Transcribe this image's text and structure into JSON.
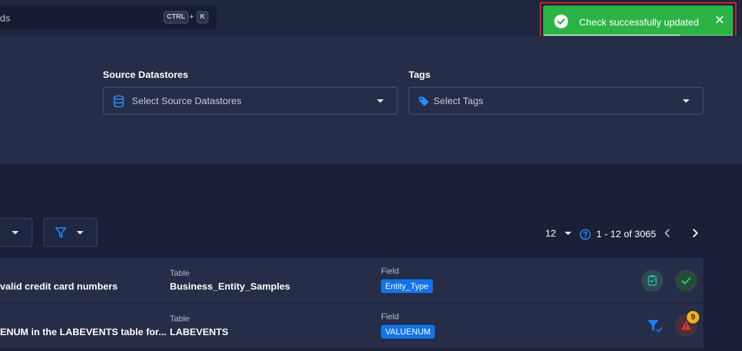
{
  "search": {
    "text": "ds",
    "shortcut_ctrl": "CTRL",
    "shortcut_plus": "+",
    "shortcut_key": "K"
  },
  "toast": {
    "message": "Check successfully updated",
    "close_label": "✕",
    "progress": 0.72,
    "color": "#2bb445"
  },
  "filters": {
    "source_datastores": {
      "label": "Source Datastores",
      "placeholder": "Select Source Datastores",
      "icon": "database-icon"
    },
    "tags": {
      "label": "Tags",
      "placeholder": "Select Tags",
      "icon": "tag-icon"
    }
  },
  "pagination": {
    "page_size": "12",
    "range": "1 - 12 of 3065"
  },
  "rows": [
    {
      "title": "valid credit card numbers",
      "container_label": "Table",
      "container_value": "Business_Entity_Samples",
      "field_label": "Field",
      "field_value": "Entity_Type"
    },
    {
      "title": "ENUM in the LABEVENTS table for...",
      "container_label": "Table",
      "container_value": "LABEVENTS",
      "field_label": "Field",
      "field_value": "VALUENUM",
      "anomaly_count": "9"
    }
  ],
  "colors": {
    "accent": "#1273e6",
    "success": "#2bb445",
    "warning": "#f2b01e",
    "danger": "#e0392b"
  }
}
